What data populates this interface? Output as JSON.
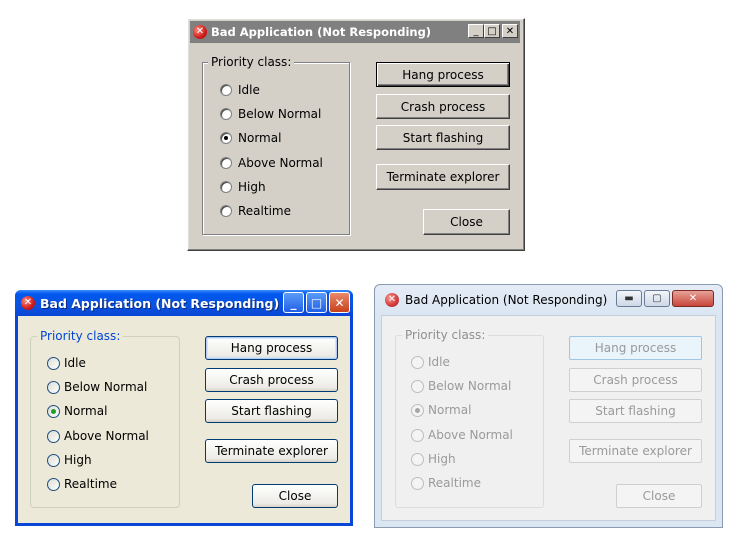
{
  "window_title": "Bad Application (Not Responding)",
  "group_label": "Priority class:",
  "priority_options": [
    "Idle",
    "Below Normal",
    "Normal",
    "Above Normal",
    "High",
    "Realtime"
  ],
  "selected_priority": "Normal",
  "buttons": {
    "hang": "Hang process",
    "crash": "Crash process",
    "flash": "Start flashing",
    "terminate": "Terminate explorer",
    "close": "Close"
  },
  "windows": [
    {
      "theme": "classic",
      "title_bar_color": "#808080"
    },
    {
      "theme": "xp-luna",
      "title_bar_color": "#0a46d6"
    },
    {
      "theme": "aero-ghosted",
      "title_bar_color": "#dbe6f3"
    }
  ],
  "icons": {
    "title": "error-icon",
    "minimize": "minimize-icon",
    "maximize": "maximize-icon",
    "close": "close-icon"
  }
}
